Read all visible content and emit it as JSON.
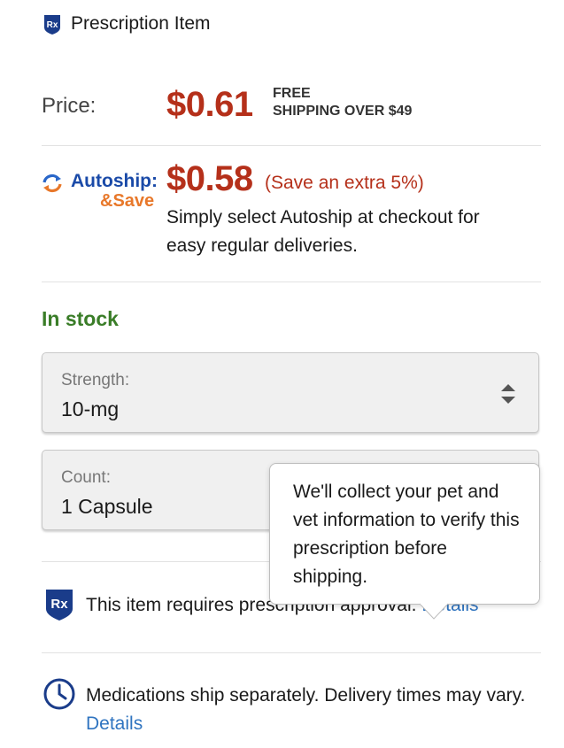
{
  "header": {
    "title": "Prescription Item",
    "icon": "rx-shield-icon"
  },
  "price": {
    "label": "Price:",
    "amount": "$0.61",
    "shipping_line1": "FREE",
    "shipping_line2": "SHIPPING OVER $49"
  },
  "autoship": {
    "icon": "autoship-refresh-icon",
    "word": "Autoship:",
    "save": "&Save",
    "price": "$0.58",
    "extra": "(Save an extra 5%)",
    "description": "Simply select Autoship at checkout for easy regular deliveries."
  },
  "stock": {
    "status": "In stock"
  },
  "strength_select": {
    "label": "Strength:",
    "value": "10-mg"
  },
  "count_select": {
    "label": "Count:",
    "value": "1 Capsule"
  },
  "prescription": {
    "text": "This item requires prescription approval.",
    "link": "Details"
  },
  "tooltip": {
    "text": "We'll collect your pet and vet information to verify this prescription before shipping."
  },
  "shipping_note": {
    "text": "Medications ship separately. Delivery times may vary.",
    "link": "Details"
  },
  "colors": {
    "price_red": "#b5301a",
    "autoship_blue": "#1a4aa8",
    "save_orange": "#e8782a",
    "stock_green": "#3a7d28",
    "link_blue": "#2f74c0"
  }
}
